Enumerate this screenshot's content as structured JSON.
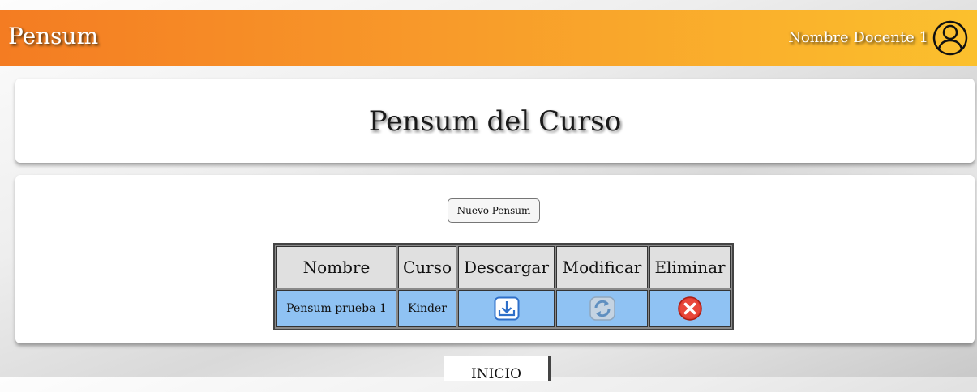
{
  "header": {
    "brand": "Pensum",
    "user_name": "Nombre Docente 1",
    "gradient_start": "#f47c22",
    "gradient_end": "#fbc02d"
  },
  "title_card": {
    "title": "Pensum del Curso"
  },
  "main": {
    "new_button_label": "Nuevo Pensum",
    "table": {
      "columns": [
        "Nombre",
        "Curso",
        "Descargar",
        "Modificar",
        "Eliminar"
      ],
      "rows": [
        {
          "nombre": "Pensum prueba 1",
          "curso": "Kinder",
          "descargar_icon": "download-icon",
          "modificar_icon": "refresh-icon",
          "eliminar_icon": "delete-icon"
        }
      ]
    }
  },
  "footer": {
    "home_label": "INICIO"
  }
}
